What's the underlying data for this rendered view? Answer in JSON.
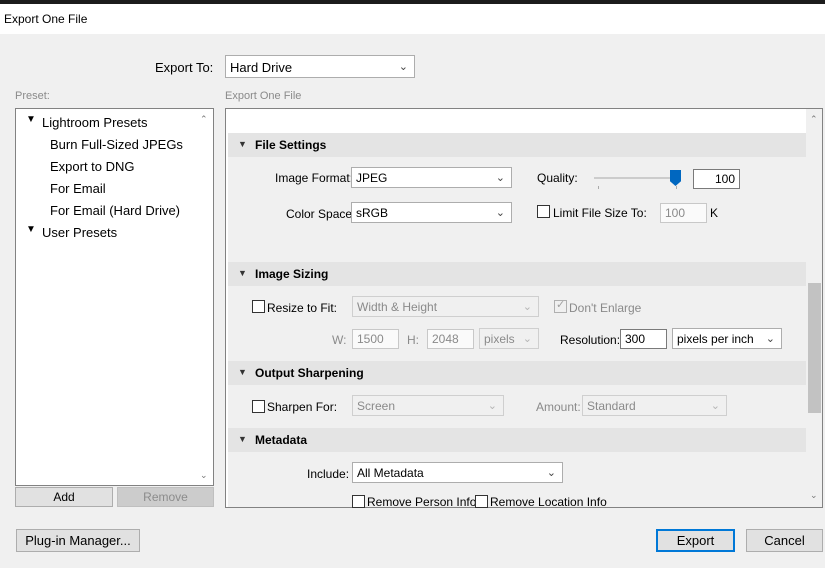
{
  "window": {
    "title": "Export One File"
  },
  "export_to": {
    "label": "Export To:",
    "value": "Hard Drive"
  },
  "preset": {
    "label": "Preset:",
    "groups": [
      {
        "label": "Lightroom Presets",
        "items": [
          "Burn Full-Sized JPEGs",
          "Export to DNG",
          "For Email",
          "For Email (Hard Drive)"
        ]
      },
      {
        "label": "User Presets",
        "items": []
      }
    ],
    "add_label": "Add",
    "remove_label": "Remove"
  },
  "panel": {
    "label": "Export One File",
    "file_settings": {
      "title": "File Settings",
      "image_format_label": "Image Format:",
      "image_format_value": "JPEG",
      "quality_label": "Quality:",
      "quality_value": "100",
      "color_space_label": "Color Space:",
      "color_space_value": "sRGB",
      "limit_size_label": "Limit File Size To:",
      "limit_size_value": "100",
      "limit_size_unit": "K"
    },
    "image_sizing": {
      "title": "Image Sizing",
      "resize_label": "Resize to Fit:",
      "resize_value": "Width & Height",
      "dont_enlarge_label": "Don't Enlarge",
      "w_label": "W:",
      "w_value": "1500",
      "h_label": "H:",
      "h_value": "2048",
      "units_value": "pixels",
      "resolution_label": "Resolution:",
      "resolution_value": "300",
      "resolution_units": "pixels per inch"
    },
    "output_sharpening": {
      "title": "Output Sharpening",
      "sharpen_label": "Sharpen For:",
      "sharpen_value": "Screen",
      "amount_label": "Amount:",
      "amount_value": "Standard"
    },
    "metadata": {
      "title": "Metadata",
      "include_label": "Include:",
      "include_value": "All Metadata",
      "remove_person_label": "Remove Person Info",
      "remove_location_label": "Remove Location Info"
    }
  },
  "footer": {
    "plugin_manager_label": "Plug-in Manager...",
    "export_label": "Export",
    "cancel_label": "Cancel"
  },
  "icons": {
    "dropdown": "chevron-down",
    "expanded": "triangle-down",
    "scroll_up": "triangle-up",
    "scroll_down": "triangle-down"
  }
}
